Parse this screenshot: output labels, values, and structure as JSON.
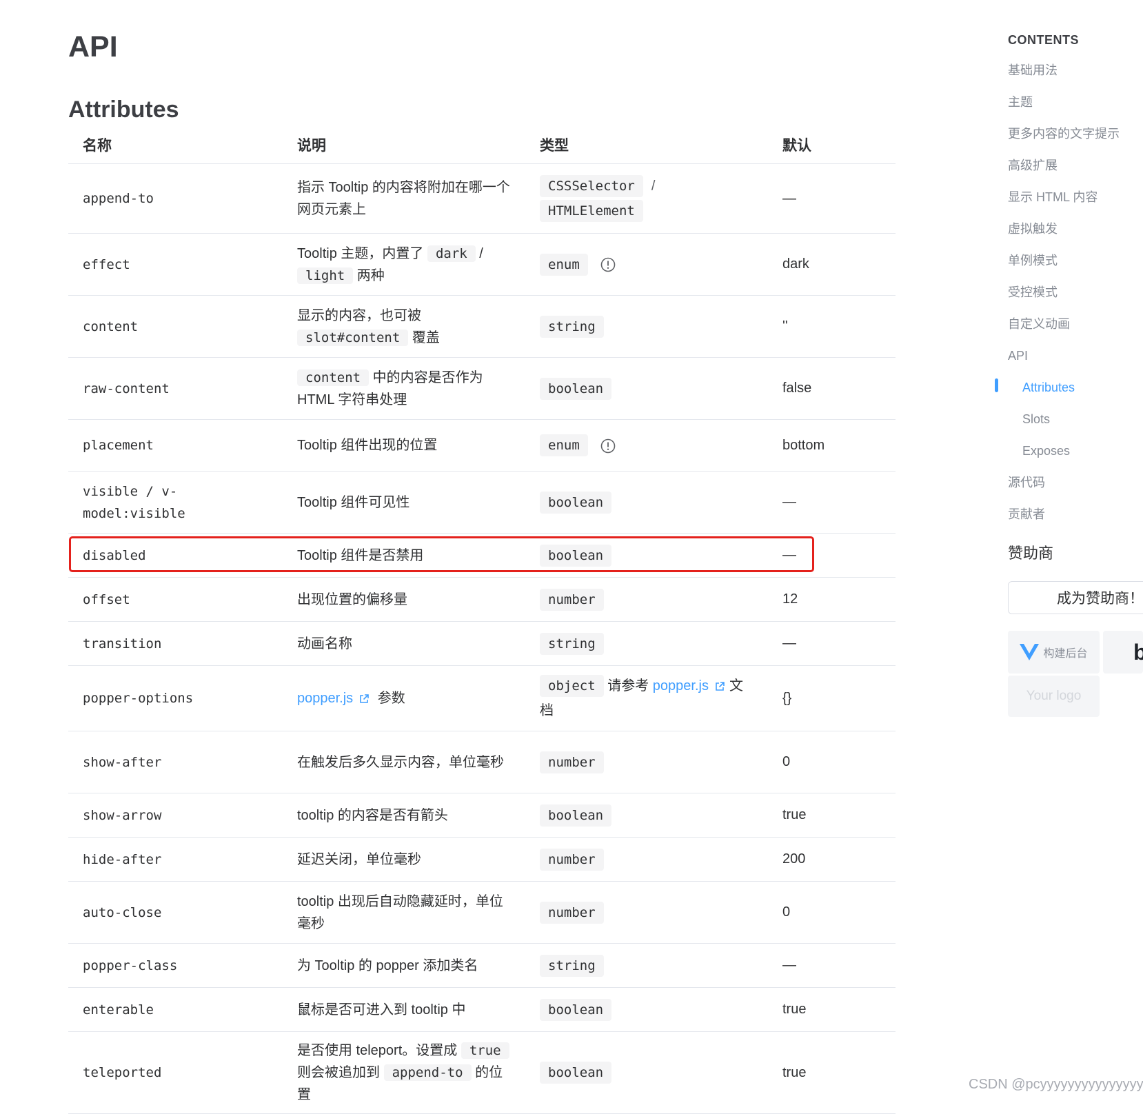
{
  "page": {
    "title": "API",
    "section": "Attributes"
  },
  "table": {
    "headers": [
      "名称",
      "说明",
      "类型",
      "默认"
    ],
    "rows": [
      {
        "name": "append-to",
        "desc": [
          {
            "t": "text",
            "v": "指示 Tooltip 的内容将附加在哪一个网页元素上"
          }
        ],
        "type": [
          {
            "t": "code",
            "v": "CSSSelector"
          },
          {
            "t": "sep",
            "v": "/"
          },
          {
            "t": "code",
            "v": "HTMLElement"
          }
        ],
        "default": "—",
        "h": 100
      },
      {
        "name": "effect",
        "desc": [
          {
            "t": "text",
            "v": "Tooltip 主题，内置了 "
          },
          {
            "t": "code",
            "v": "dark"
          },
          {
            "t": "text",
            "v": " / "
          },
          {
            "t": "code",
            "v": "light"
          },
          {
            "t": "text",
            "v": " 两种"
          }
        ],
        "type": [
          {
            "t": "code",
            "v": "enum"
          },
          {
            "t": "info",
            "v": "info-circle-icon"
          }
        ],
        "default": "dark",
        "h": 89
      },
      {
        "name": "content",
        "desc": [
          {
            "t": "text",
            "v": "显示的内容，也可被 "
          },
          {
            "t": "code",
            "v": "slot#content"
          },
          {
            "t": "text",
            "v": " 覆盖"
          }
        ],
        "type": [
          {
            "t": "code",
            "v": "string"
          }
        ],
        "default": "''",
        "h": 89
      },
      {
        "name": "raw-content",
        "desc": [
          {
            "t": "code",
            "v": "content"
          },
          {
            "t": "text",
            "v": " 中的内容是否作为 HTML 字符串处理"
          }
        ],
        "type": [
          {
            "t": "code",
            "v": "boolean"
          }
        ],
        "default": "false",
        "h": 89
      },
      {
        "name": "placement",
        "desc": [
          {
            "t": "text",
            "v": "Tooltip 组件出现的位置"
          }
        ],
        "type": [
          {
            "t": "code",
            "v": "enum"
          },
          {
            "t": "info",
            "v": "info-circle-icon"
          }
        ],
        "default": "bottom",
        "h": 74
      },
      {
        "name": "visible / v-model:visible",
        "desc": [
          {
            "t": "text",
            "v": "Tooltip 组件可见性"
          }
        ],
        "type": [
          {
            "t": "code",
            "v": "boolean"
          }
        ],
        "default": "—",
        "h": 89
      },
      {
        "name": "disabled",
        "desc": [
          {
            "t": "text",
            "v": "Tooltip 组件是否禁用"
          }
        ],
        "type": [
          {
            "t": "code",
            "v": "boolean"
          }
        ],
        "default": "—",
        "h": 63
      },
      {
        "name": "offset",
        "desc": [
          {
            "t": "text",
            "v": "出现位置的偏移量"
          }
        ],
        "type": [
          {
            "t": "code",
            "v": "number"
          }
        ],
        "default": "12",
        "h": 63
      },
      {
        "name": "transition",
        "desc": [
          {
            "t": "text",
            "v": "动画名称"
          }
        ],
        "type": [
          {
            "t": "code",
            "v": "string"
          }
        ],
        "default": "—",
        "h": 63
      },
      {
        "name": "popper-options",
        "desc": [
          {
            "t": "link",
            "v": "popper.js"
          },
          {
            "t": "ext",
            "v": "external-link-icon"
          },
          {
            "t": "text",
            "v": " 参数"
          }
        ],
        "type": [
          {
            "t": "code",
            "v": "object"
          },
          {
            "t": "text",
            "v": " 请参考 "
          },
          {
            "t": "link",
            "v": "popper.js"
          },
          {
            "t": "ext",
            "v": "external-link-icon"
          },
          {
            "t": "text",
            "v": "文档"
          }
        ],
        "default": "{}",
        "h": 94
      },
      {
        "name": "show-after",
        "desc": [
          {
            "t": "text",
            "v": "在触发后多久显示内容，单位毫秒"
          }
        ],
        "type": [
          {
            "t": "code",
            "v": "number"
          }
        ],
        "default": "0",
        "h": 89
      },
      {
        "name": "show-arrow",
        "desc": [
          {
            "t": "text",
            "v": "tooltip 的内容是否有箭头"
          }
        ],
        "type": [
          {
            "t": "code",
            "v": "boolean"
          }
        ],
        "default": "true",
        "h": 63
      },
      {
        "name": "hide-after",
        "desc": [
          {
            "t": "text",
            "v": "延迟关闭，单位毫秒"
          }
        ],
        "type": [
          {
            "t": "code",
            "v": "number"
          }
        ],
        "default": "200",
        "h": 63
      },
      {
        "name": "auto-close",
        "desc": [
          {
            "t": "text",
            "v": "tooltip 出现后自动隐藏延时，单位毫秒"
          }
        ],
        "type": [
          {
            "t": "code",
            "v": "number"
          }
        ],
        "default": "0",
        "h": 89
      },
      {
        "name": "popper-class",
        "desc": [
          {
            "t": "text",
            "v": "为 Tooltip 的 popper 添加类名"
          }
        ],
        "type": [
          {
            "t": "code",
            "v": "string"
          }
        ],
        "default": "—",
        "h": 63
      },
      {
        "name": "enterable",
        "desc": [
          {
            "t": "text",
            "v": "鼠标是否可进入到 tooltip 中"
          }
        ],
        "type": [
          {
            "t": "code",
            "v": "boolean"
          }
        ],
        "default": "true",
        "h": 63
      },
      {
        "name": "teleported",
        "desc": [
          {
            "t": "text",
            "v": "是否使用 teleport。设置成 "
          },
          {
            "t": "code",
            "v": "true"
          },
          {
            "t": "text",
            "v": " 则会被追加到 "
          },
          {
            "t": "code",
            "v": "append-to"
          },
          {
            "t": "text",
            "v": " 的位置"
          }
        ],
        "type": [
          {
            "t": "code",
            "v": "boolean"
          }
        ],
        "default": "true",
        "h": 118
      }
    ]
  },
  "toc": {
    "heading": "CONTENTS",
    "items": [
      {
        "label": "基础用法",
        "sub": false,
        "active": false
      },
      {
        "label": "主题",
        "sub": false,
        "active": false
      },
      {
        "label": "更多内容的文字提示",
        "sub": false,
        "active": false
      },
      {
        "label": "高级扩展",
        "sub": false,
        "active": false
      },
      {
        "label": "显示 HTML 内容",
        "sub": false,
        "active": false
      },
      {
        "label": "虚拟触发",
        "sub": false,
        "active": false
      },
      {
        "label": "单例模式",
        "sub": false,
        "active": false
      },
      {
        "label": "受控模式",
        "sub": false,
        "active": false
      },
      {
        "label": "自定义动画",
        "sub": false,
        "active": false
      },
      {
        "label": "API",
        "sub": false,
        "active": false
      },
      {
        "label": "Attributes",
        "sub": true,
        "active": true
      },
      {
        "label": "Slots",
        "sub": true,
        "active": false
      },
      {
        "label": "Exposes",
        "sub": true,
        "active": false
      },
      {
        "label": "源代码",
        "sub": false,
        "active": false
      },
      {
        "label": "贡献者",
        "sub": false,
        "active": false
      }
    ]
  },
  "sponsors": {
    "title": "赞助商",
    "button": "成为赞助商！",
    "logo1_text": "构建后台",
    "logo2_text": "b",
    "logo3_text": "Your logo"
  },
  "watermark": "CSDN @pcyyyyyyyyyyyyyyyyy",
  "colors": {
    "accent": "#409eff",
    "highlight": "#e4211c",
    "code_bg": "#f4f4f5"
  }
}
